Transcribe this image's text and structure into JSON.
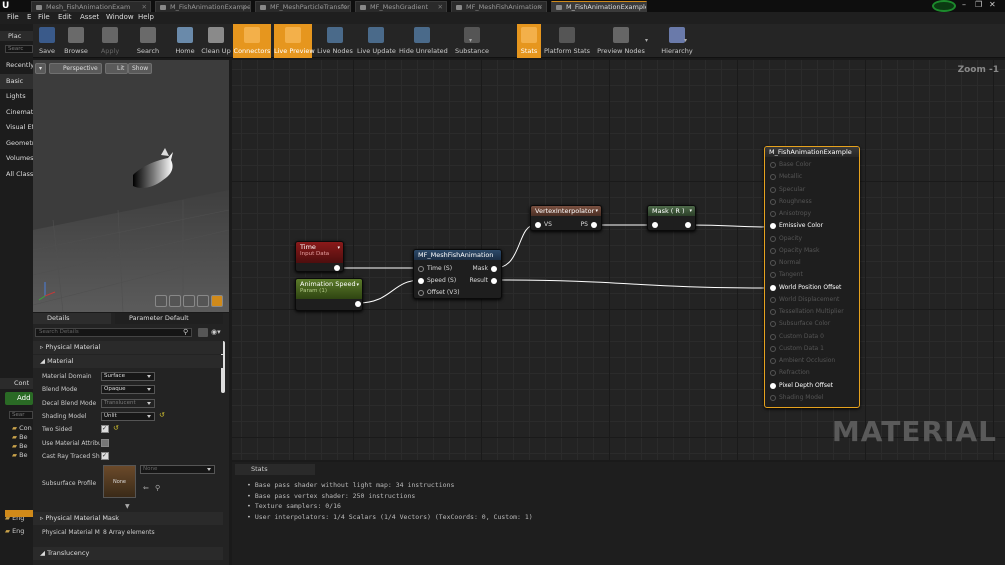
{
  "tabs": [
    "Mesh_FishAnimationExam",
    "M_FishAnimationExampe",
    "MF_MeshParticleTransfor",
    "MF_MeshGradient",
    "MF_MeshFishAnimation",
    "M_FishAnimationExample"
  ],
  "menu": [
    "File",
    "Edit",
    "Asset",
    "Window",
    "Help"
  ],
  "left_menu": [
    "File",
    "E"
  ],
  "toolbar": {
    "items": [
      "Save",
      "Browse",
      "Apply",
      "Search",
      "Home",
      "Clean Up",
      "Connectors",
      "Live Preview",
      "Live Nodes",
      "Live Update",
      "Hide Unrelated",
      "Substance",
      "Stats",
      "Platform Stats",
      "Preview Nodes",
      "Hierarchy"
    ],
    "active": [
      "Connectors",
      "Live Preview",
      "Stats"
    ]
  },
  "left_panel": {
    "title": "Plac",
    "search": "Searc",
    "items": [
      "Recently",
      "Basic",
      "Lights",
      "Cinemat",
      "Visual Ef",
      "Geometr",
      "Volumes",
      "All Class"
    ]
  },
  "viewport": {
    "perspective": "Perspective",
    "lit": "Lit",
    "show": "Show"
  },
  "details": {
    "tab1": "Details",
    "tab2": "Parameter Default",
    "search_placeholder": "Search Details",
    "sections": [
      "Physical Material",
      "Material",
      "Physical Material Mask",
      "Translucency"
    ],
    "properties": [
      {
        "label": "Material Domain",
        "value": "Surface",
        "kind": "combo"
      },
      {
        "label": "Blend Mode",
        "value": "Opaque",
        "kind": "combo"
      },
      {
        "label": "Decal Blend Mode",
        "value": "Translucent",
        "kind": "combo"
      },
      {
        "label": "Shading Model",
        "value": "Unlit",
        "kind": "combo"
      },
      {
        "label": "Two Sided",
        "value": "",
        "kind": "check"
      },
      {
        "label": "Use Material Attribut",
        "value": "",
        "kind": "check-off"
      },
      {
        "label": "Cast Ray Traced Shad",
        "value": "",
        "kind": "check"
      }
    ],
    "subsurface_label": "Subsurface Profile",
    "subsurface_thumb": "None",
    "subsurface_value": "None",
    "mask_label": "Physical Material Ma",
    "mask_value": "8 Array elements"
  },
  "content_browser": {
    "title": "Cont",
    "add": "Add",
    "search": "Sear",
    "tree": [
      "Con",
      "Be",
      "Be",
      "Be",
      "Eng",
      "Eng"
    ]
  },
  "graph": {
    "zoom": "Zoom -1",
    "watermark": "MATERIAL",
    "nodes": {
      "time": {
        "title": "Time",
        "subtitle": "Input Data"
      },
      "speed": {
        "title": "Animation Speed",
        "subtitle": "Param (1)"
      },
      "func": {
        "title": "MF_MeshFishAnimation",
        "inputs": [
          "Time (S)",
          "Speed (S)",
          "Offset (V3)"
        ],
        "outputs": [
          "Mask",
          "Result"
        ]
      },
      "vi": {
        "title": "VertexInterpolator",
        "in": "VS",
        "out": "PS"
      },
      "mask": {
        "title": "Mask ( R )"
      },
      "result": {
        "title": "M_FishAnimationExample",
        "pins": [
          "Base Color",
          "Metallic",
          "Specular",
          "Roughness",
          "Anisotropy",
          "Emissive Color",
          "Opacity",
          "Opacity Mask",
          "Normal",
          "Tangent",
          "World Position Offset",
          "World Displacement",
          "Tessellation Multiplier",
          "Subsurface Color",
          "Custom Data 0",
          "Custom Data 1",
          "Ambient Occlusion",
          "Refraction",
          "Pixel Depth Offset",
          "Shading Model"
        ],
        "active": [
          "Emissive Color",
          "World Position Offset",
          "Pixel Depth Offset"
        ]
      }
    }
  },
  "stats": {
    "title": "Stats",
    "lines": [
      "Base pass shader without light map: 34 instructions",
      "Base pass vertex shader: 250 instructions",
      "Texture samplers: 0/16",
      "User interpolators: 1/4 Scalars (1/4 Vectors) (TexCoords: 0, Custom: 1)"
    ]
  }
}
